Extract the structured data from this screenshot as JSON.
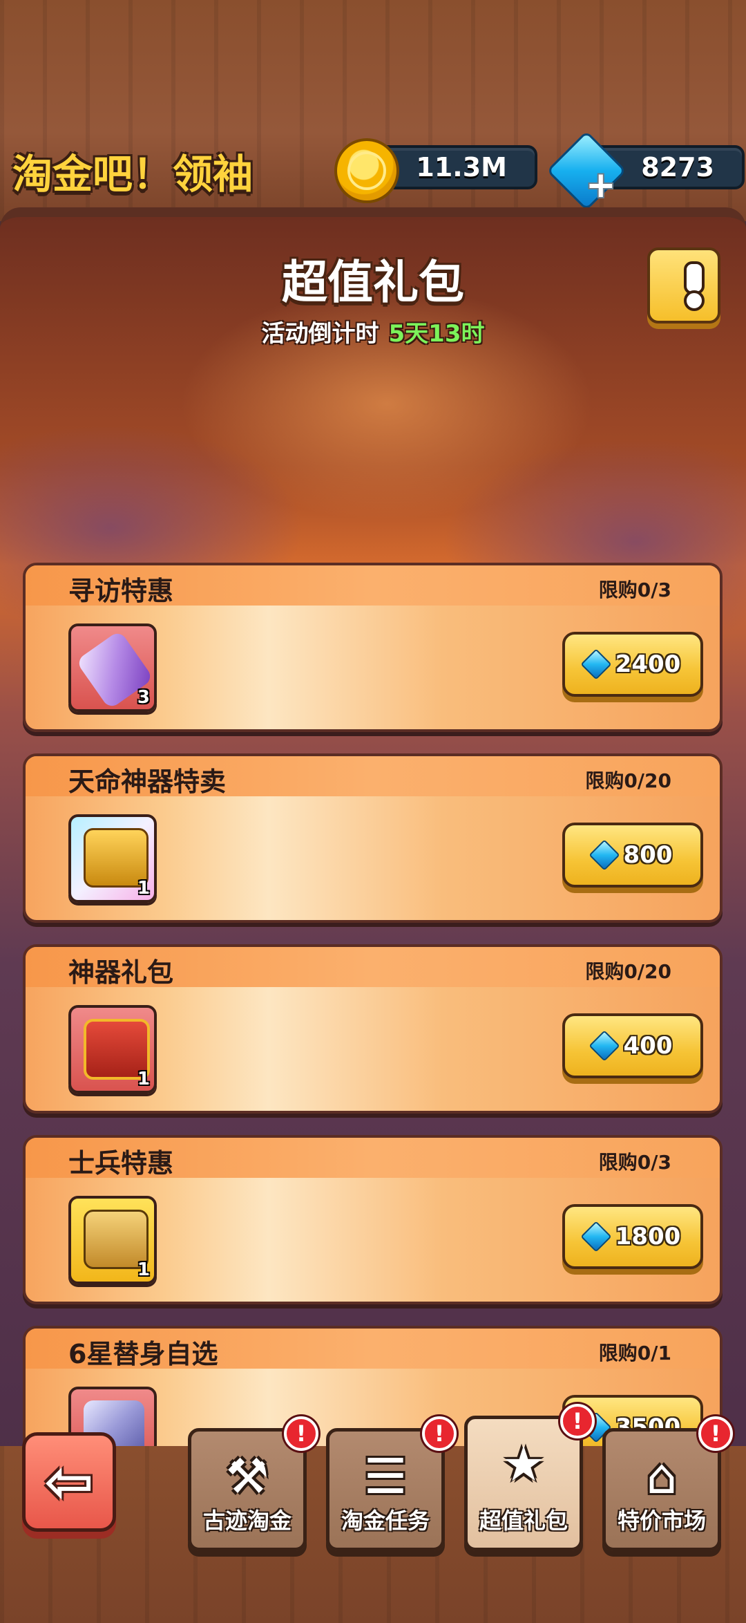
{
  "header": {
    "title": "淘金吧！领袖",
    "gold": "11.3M",
    "gems": "8273"
  },
  "panel": {
    "title": "超值礼包",
    "countdown_label": "活动倒计时",
    "countdown_value": "5天13时",
    "info_icon": "exclamation-icon"
  },
  "offers": [
    {
      "title": "寻访特惠",
      "limit": "限购0/3",
      "count": "3",
      "price": "2400",
      "icon": "scroll-icon"
    },
    {
      "title": "天命神器特卖",
      "limit": "限购0/20",
      "count": "1",
      "price": "800",
      "icon": "chest-icon"
    },
    {
      "title": "神器礼包",
      "limit": "限购0/20",
      "count": "1",
      "price": "400",
      "icon": "red-chest-icon"
    },
    {
      "title": "士兵特惠",
      "limit": "限购0/3",
      "count": "1",
      "price": "1800",
      "icon": "mask-chest-icon"
    },
    {
      "title": "6星替身自选",
      "limit": "限购0/1",
      "count": "",
      "price": "3500",
      "icon": "crystal-icon"
    }
  ],
  "nav": {
    "back_icon": "back-arrow-icon",
    "tabs": [
      {
        "label": "古迹淘金",
        "icon": "pickaxe-icon",
        "badge": "!"
      },
      {
        "label": "淘金任务",
        "icon": "clipboard-icon",
        "badge": "!"
      },
      {
        "label": "超值礼包",
        "icon": "gift-icon",
        "badge": "!"
      },
      {
        "label": "特价市场",
        "icon": "shop-icon",
        "badge": "!"
      }
    ]
  },
  "colors": {
    "gold_text": "#ffd33d",
    "countdown_green": "#7cf35a",
    "button_yellow": "#f6c436",
    "badge_red": "#e8262f"
  }
}
